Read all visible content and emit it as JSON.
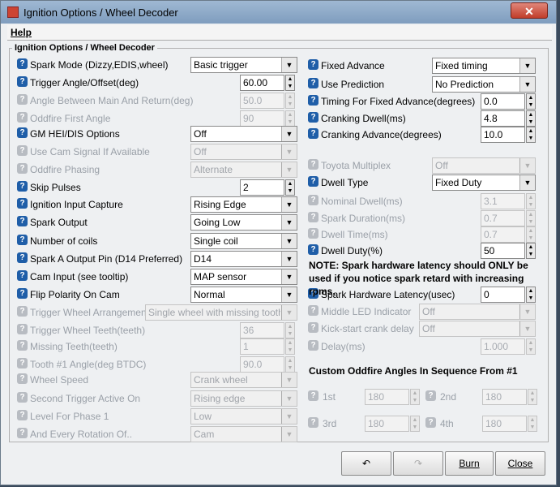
{
  "window": {
    "title": "Ignition Options / Wheel Decoder",
    "close_glyph": "✕"
  },
  "menu": {
    "help": "Help"
  },
  "group": {
    "title": "Ignition Options / Wheel Decoder"
  },
  "left": [
    {
      "label": "Spark Mode (Dizzy,EDIS,wheel)",
      "type": "combo",
      "value": "Basic trigger",
      "enabled": true
    },
    {
      "label": "Trigger Angle/Offset(deg)",
      "type": "spin",
      "value": "60.00",
      "enabled": true
    },
    {
      "label": "Angle Between Main And Return(deg)",
      "type": "spin",
      "value": "50.0",
      "enabled": false
    },
    {
      "label": "Oddfire First Angle",
      "type": "spin",
      "value": "90",
      "enabled": false
    },
    {
      "label": "GM HEI/DIS Options",
      "type": "combo",
      "value": "Off",
      "enabled": true
    },
    {
      "label": "Use Cam Signal If Available",
      "type": "combo",
      "value": "Off",
      "enabled": false
    },
    {
      "label": "Oddfire Phasing",
      "type": "combo",
      "value": "Alternate",
      "enabled": false
    },
    {
      "label": "Skip Pulses",
      "type": "spin",
      "value": "2",
      "enabled": true
    },
    {
      "label": "Ignition Input Capture",
      "type": "combo",
      "value": "Rising Edge",
      "enabled": true
    },
    {
      "label": "Spark Output",
      "type": "combo",
      "value": "Going Low",
      "enabled": true
    },
    {
      "label": "Number of coils",
      "type": "combo",
      "value": "Single coil",
      "enabled": true
    },
    {
      "label": "Spark A Output Pin (D14 Preferred)",
      "type": "combo",
      "value": "D14",
      "enabled": true
    },
    {
      "label": "Cam Input (see tooltip)",
      "type": "combo",
      "value": "MAP sensor",
      "enabled": true
    },
    {
      "label": "Flip Polarity On Cam",
      "type": "combo",
      "value": "Normal",
      "enabled": true
    },
    {
      "label": "Trigger Wheel Arrangement",
      "type": "combo",
      "value": "Single wheel with missing tooth",
      "enabled": false,
      "wide": true
    },
    {
      "label": "Trigger Wheel Teeth(teeth)",
      "type": "spin",
      "value": "36",
      "enabled": false
    },
    {
      "label": "Missing Teeth(teeth)",
      "type": "spin",
      "value": "1",
      "enabled": false
    },
    {
      "label": "Tooth #1 Angle(deg BTDC)",
      "type": "spin",
      "value": "90.0",
      "enabled": false
    },
    {
      "label": "Wheel Speed",
      "type": "combo",
      "value": "Crank wheel",
      "enabled": false
    },
    {
      "label": "Second Trigger Active On",
      "type": "combo",
      "value": "Rising edge",
      "enabled": false
    },
    {
      "label": "Level For Phase 1",
      "type": "combo",
      "value": "Low",
      "enabled": false
    },
    {
      "label": "And Every Rotation Of..",
      "type": "combo",
      "value": "Cam",
      "enabled": false
    }
  ],
  "right_top": [
    {
      "label": "Fixed Advance",
      "type": "combo",
      "value": "Fixed timing",
      "enabled": true
    },
    {
      "label": "Use Prediction",
      "type": "combo",
      "value": "No Prediction",
      "enabled": true
    },
    {
      "label": "Timing For Fixed Advance(degrees)",
      "type": "spin",
      "value": "0.0",
      "enabled": true
    },
    {
      "label": "Cranking Dwell(ms)",
      "type": "spin",
      "value": "4.8",
      "enabled": true
    },
    {
      "label": "Cranking Advance(degrees)",
      "type": "spin",
      "value": "10.0",
      "enabled": true
    }
  ],
  "right_mid": [
    {
      "label": "Toyota Multiplex",
      "type": "combo",
      "value": "Off",
      "enabled": false
    },
    {
      "label": "Dwell Type",
      "type": "combo",
      "value": "Fixed Duty",
      "enabled": true
    },
    {
      "label": "Nominal Dwell(ms)",
      "type": "spin",
      "value": "3.1",
      "enabled": false
    },
    {
      "label": "Spark Duration(ms)",
      "type": "spin",
      "value": "0.7",
      "enabled": false
    },
    {
      "label": "Dwell Time(ms)",
      "type": "spin",
      "value": "0.7",
      "enabled": false
    },
    {
      "label": "Dwell Duty(%)",
      "type": "spin",
      "value": "50",
      "enabled": true
    }
  ],
  "note": "NOTE: Spark hardware latency should ONLY be used if you notice spark retard with increasing rpms.",
  "right_low": [
    {
      "label": "Spark Hardware Latency(usec)",
      "type": "spin",
      "value": "0",
      "enabled": true
    },
    {
      "label": "Middle LED Indicator",
      "type": "combo",
      "value": "Off",
      "enabled": false
    },
    {
      "label": "Kick-start crank delay",
      "type": "combo",
      "value": "Off",
      "enabled": false
    },
    {
      "label": "Delay(ms)",
      "type": "spin",
      "value": "1.000",
      "enabled": false
    }
  ],
  "oddfire": {
    "title": "Custom Oddfire Angles In Sequence From #1",
    "items": [
      {
        "label": "1st",
        "value": "180"
      },
      {
        "label": "2nd",
        "value": "180"
      },
      {
        "label": "3rd",
        "value": "180"
      },
      {
        "label": "4th",
        "value": "180"
      }
    ]
  },
  "buttons": {
    "undo_icon": "↶",
    "redo_icon": "↷",
    "burn": "Burn",
    "close": "Close"
  },
  "icons": {
    "help": "?",
    "arrow": "▼",
    "spin_up": "▲",
    "spin_down": "▼"
  }
}
